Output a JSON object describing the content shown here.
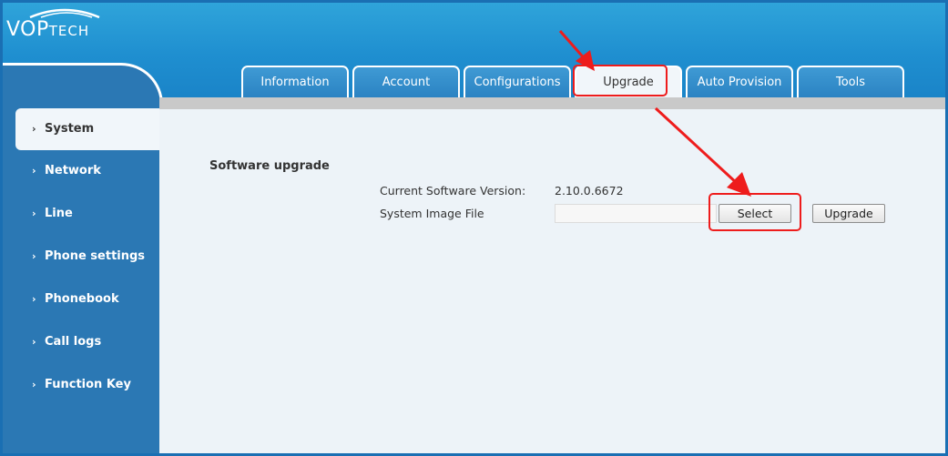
{
  "brand": {
    "logo_main": "VOP",
    "logo_sub": "TECH"
  },
  "tabs": [
    {
      "label": "Information"
    },
    {
      "label": "Account"
    },
    {
      "label": "Configurations"
    },
    {
      "label": "Upgrade",
      "active": true
    },
    {
      "label": "Auto Provision"
    },
    {
      "label": "Tools"
    }
  ],
  "sidebar": {
    "items": [
      {
        "label": "System",
        "active": true
      },
      {
        "label": "Network"
      },
      {
        "label": "Line"
      },
      {
        "label": "Phone settings"
      },
      {
        "label": "Phonebook"
      },
      {
        "label": "Call logs"
      },
      {
        "label": "Function Key"
      }
    ]
  },
  "upgrade": {
    "section_title": "Software upgrade",
    "current_version_label": "Current Software Version:",
    "current_version_value": "2.10.0.6672",
    "image_file_label": "System Image File",
    "image_file_value": "",
    "select_label": "Select",
    "upgrade_label": "Upgrade"
  },
  "colors": {
    "header": "#1f8fd0",
    "sidebar": "#2b78b4",
    "content_bg": "#edf3f8",
    "annotation": "#ee1c1c"
  }
}
